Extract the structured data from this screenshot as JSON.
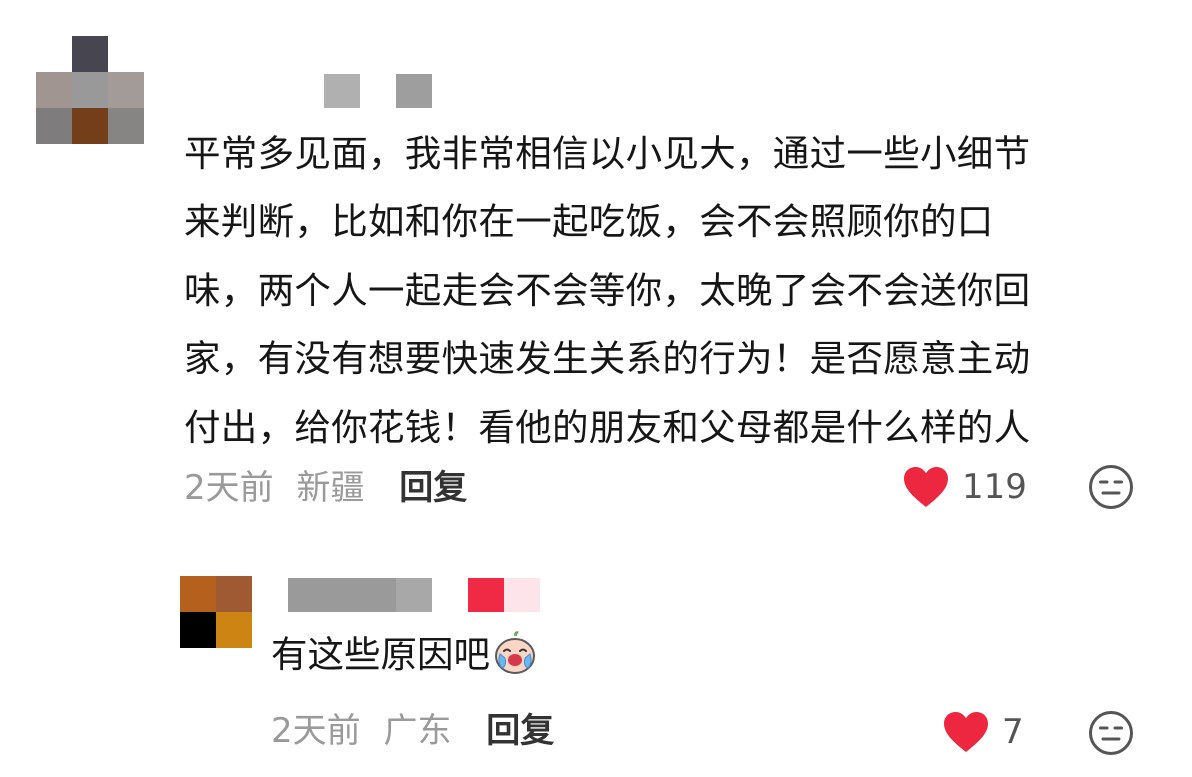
{
  "comment": {
    "avatar_pixels": [
      "#ffffff",
      "#474650",
      "#ffffff",
      "#a19591",
      "#999999",
      "#a39b98",
      "#7e7c7d",
      "#753e1a",
      "#878584"
    ],
    "name_pixels": [
      "#b0b0b0",
      "#ffffff",
      "#9e9e9e"
    ],
    "lines": [
      "平常多见面，我非常相信以小见大，通过一些小细节",
      "来判断，比如和你在一起吃饭，会不会照顾你的口",
      "味，两个人一起走会不会等你，太晚了会不会送你回",
      "家，有没有想要快速发生关系的行为！是否愿意主动",
      "付出，给你花钱！看他的朋友和父母都是什么样的人"
    ],
    "time": "2天前",
    "location": "新疆",
    "reply_label": "回复",
    "like_count": "119",
    "like_icon": "heart-icon",
    "dislike_icon": "dislike-face-icon"
  },
  "reply": {
    "avatar_pixels": [
      "#b5601c",
      "#a05a33",
      "#000000",
      "#cc8512"
    ],
    "name_pixels": [
      "#9a9a9a",
      "#9a9a9a",
      "#9a9a9a",
      "#a8a8a8"
    ],
    "badge_pixels": [
      "#f02945",
      "#fde4ea"
    ],
    "text": "有这些原因吧",
    "emoji": "crying-emoji-icon",
    "time": "2天前",
    "location": "广东",
    "reply_label": "回复",
    "like_count": "7",
    "like_icon": "heart-icon",
    "dislike_icon": "dislike-face-icon"
  },
  "colors": {
    "heart": "#ee2741",
    "meta_gray": "#9a9a9a",
    "text": "#161616"
  }
}
